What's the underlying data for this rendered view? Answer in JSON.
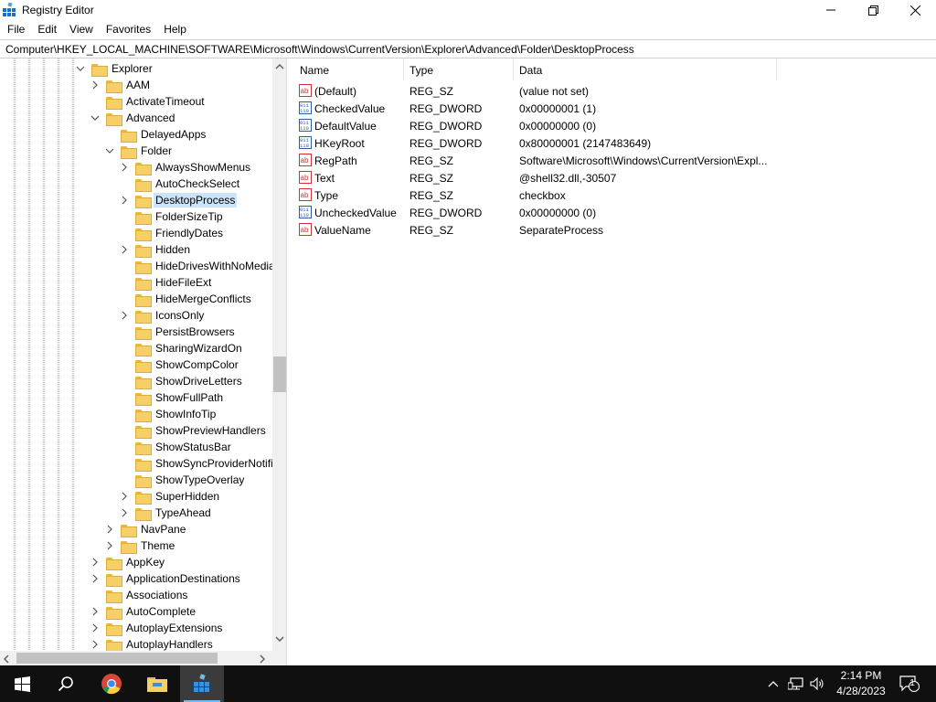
{
  "window": {
    "title": "Registry Editor"
  },
  "menu": [
    "File",
    "Edit",
    "View",
    "Favorites",
    "Help"
  ],
  "address": "Computer\\HKEY_LOCAL_MACHINE\\SOFTWARE\\Microsoft\\Windows\\CurrentVersion\\Explorer\\Advanced\\Folder\\DesktopProcess",
  "tree": [
    {
      "label": "Explorer",
      "expander": "open"
    },
    {
      "label": "AAM",
      "expander": "closed"
    },
    {
      "label": "ActivateTimeout",
      "expander": "none"
    },
    {
      "label": "Advanced",
      "expander": "open"
    },
    {
      "label": "DelayedApps",
      "expander": "none"
    },
    {
      "label": "Folder",
      "expander": "open"
    },
    {
      "label": "AlwaysShowMenus",
      "expander": "closed"
    },
    {
      "label": "AutoCheckSelect",
      "expander": "none"
    },
    {
      "label": "DesktopProcess",
      "expander": "closed",
      "selected": true
    },
    {
      "label": "FolderSizeTip",
      "expander": "none"
    },
    {
      "label": "FriendlyDates",
      "expander": "none"
    },
    {
      "label": "Hidden",
      "expander": "closed"
    },
    {
      "label": "HideDrivesWithNoMedia",
      "expander": "none"
    },
    {
      "label": "HideFileExt",
      "expander": "none"
    },
    {
      "label": "HideMergeConflicts",
      "expander": "none"
    },
    {
      "label": "IconsOnly",
      "expander": "closed"
    },
    {
      "label": "PersistBrowsers",
      "expander": "none"
    },
    {
      "label": "SharingWizardOn",
      "expander": "none"
    },
    {
      "label": "ShowCompColor",
      "expander": "none"
    },
    {
      "label": "ShowDriveLetters",
      "expander": "none"
    },
    {
      "label": "ShowFullPath",
      "expander": "none"
    },
    {
      "label": "ShowInfoTip",
      "expander": "none"
    },
    {
      "label": "ShowPreviewHandlers",
      "expander": "none"
    },
    {
      "label": "ShowStatusBar",
      "expander": "none"
    },
    {
      "label": "ShowSyncProviderNotifications",
      "expander": "none"
    },
    {
      "label": "ShowTypeOverlay",
      "expander": "none"
    },
    {
      "label": "SuperHidden",
      "expander": "closed"
    },
    {
      "label": "TypeAhead",
      "expander": "closed"
    },
    {
      "label": "NavPane",
      "expander": "closed"
    },
    {
      "label": "Theme",
      "expander": "closed"
    },
    {
      "label": "AppKey",
      "expander": "closed"
    },
    {
      "label": "ApplicationDestinations",
      "expander": "closed"
    },
    {
      "label": "Associations",
      "expander": "none"
    },
    {
      "label": "AutoComplete",
      "expander": "closed"
    },
    {
      "label": "AutoplayExtensions",
      "expander": "closed"
    },
    {
      "label": "AutoplayHandlers",
      "expander": "closed"
    }
  ],
  "columns": {
    "name": "Name",
    "type": "Type",
    "data": "Data"
  },
  "values": [
    {
      "name": "(Default)",
      "type": "REG_SZ",
      "data": "(value not set)",
      "icon": "string-value-icon"
    },
    {
      "name": "CheckedValue",
      "type": "REG_DWORD",
      "data": "0x00000001 (1)",
      "icon": "binary-value-icon"
    },
    {
      "name": "DefaultValue",
      "type": "REG_DWORD",
      "data": "0x00000000 (0)",
      "icon": "binary-value-icon"
    },
    {
      "name": "HKeyRoot",
      "type": "REG_DWORD",
      "data": "0x80000001 (2147483649)",
      "icon": "binary-value-icon"
    },
    {
      "name": "RegPath",
      "type": "REG_SZ",
      "data": "Software\\Microsoft\\Windows\\CurrentVersion\\Expl...",
      "icon": "string-value-icon"
    },
    {
      "name": "Text",
      "type": "REG_SZ",
      "data": "@shell32.dll,-30507",
      "icon": "string-value-icon"
    },
    {
      "name": "Type",
      "type": "REG_SZ",
      "data": "checkbox",
      "icon": "string-value-icon"
    },
    {
      "name": "UncheckedValue",
      "type": "REG_DWORD",
      "data": "0x00000000 (0)",
      "icon": "binary-value-icon"
    },
    {
      "name": "ValueName",
      "type": "REG_SZ",
      "data": "SeparateProcess",
      "icon": "string-value-icon"
    }
  ],
  "taskbar": {
    "apps": [
      "start-icon",
      "search-icon",
      "chrome-icon",
      "file-explorer-icon",
      "registry-editor-icon"
    ],
    "time": "2:14 PM",
    "date": "4/28/2023",
    "notification_count": "1"
  },
  "colors": {
    "selection": "#cce4f7",
    "taskbar": "#101010",
    "folder": "#f5cf67"
  }
}
